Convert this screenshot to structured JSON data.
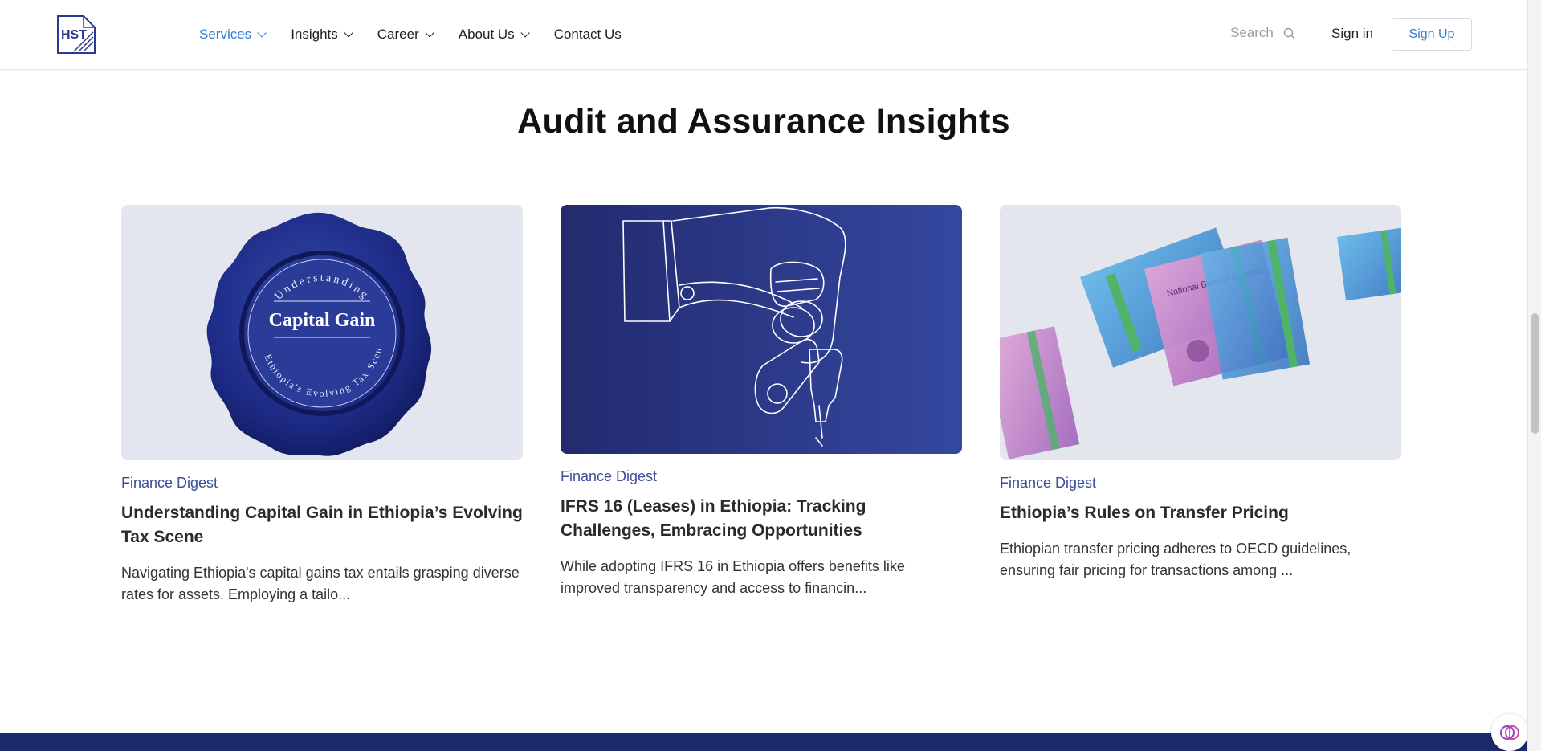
{
  "header": {
    "logo_text": "HST",
    "nav": [
      {
        "label": "Services",
        "has_dropdown": true,
        "active": true
      },
      {
        "label": "Insights",
        "has_dropdown": true,
        "active": false
      },
      {
        "label": "Career",
        "has_dropdown": true,
        "active": false
      },
      {
        "label": "About Us",
        "has_dropdown": true,
        "active": false
      },
      {
        "label": "Contact Us",
        "has_dropdown": false,
        "active": false
      }
    ],
    "search_label": "Search",
    "signin_label": "Sign in",
    "signup_label": "Sign Up"
  },
  "section": {
    "title": "Audit and Assurance Insights"
  },
  "cards": [
    {
      "image_icon": "wax-seal-image",
      "seal_top_text": "Understanding",
      "seal_center_text": "Capital Gain",
      "seal_bottom_text": "in Ethiopia's Evolving Tax Scene",
      "category": "Finance Digest",
      "title": "Understanding Capital Gain in Ethiopia’s Evolving Tax Scene",
      "description": "Navigating Ethiopia's capital gains tax entails grasping diverse rates for assets. Employing a tailo..."
    },
    {
      "image_icon": "hand-holding-keys-image",
      "category": "Finance Digest",
      "title": "IFRS 16 (Leases) in Ethiopia: Tracking Challenges, Embracing Opportunities",
      "description": "While adopting IFRS 16 in Ethiopia offers benefits like improved transparency and access to financin..."
    },
    {
      "image_icon": "ethiopian-banknotes-image",
      "banknote_text": "National Bank of Ethiopia",
      "category": "Finance Digest",
      "title": "Ethiopia’s Rules on Transfer Pricing",
      "description": "Ethiopian transfer pricing adheres to OECD guidelines, ensuring fair pricing for transactions among ..."
    }
  ],
  "colors": {
    "accent_blue": "#2f7fd6",
    "category_blue": "#3a4d9a",
    "footer_navy": "#1c2a6b",
    "seal_blue": "#1e2f86",
    "keys_bg": "#262f7a"
  }
}
